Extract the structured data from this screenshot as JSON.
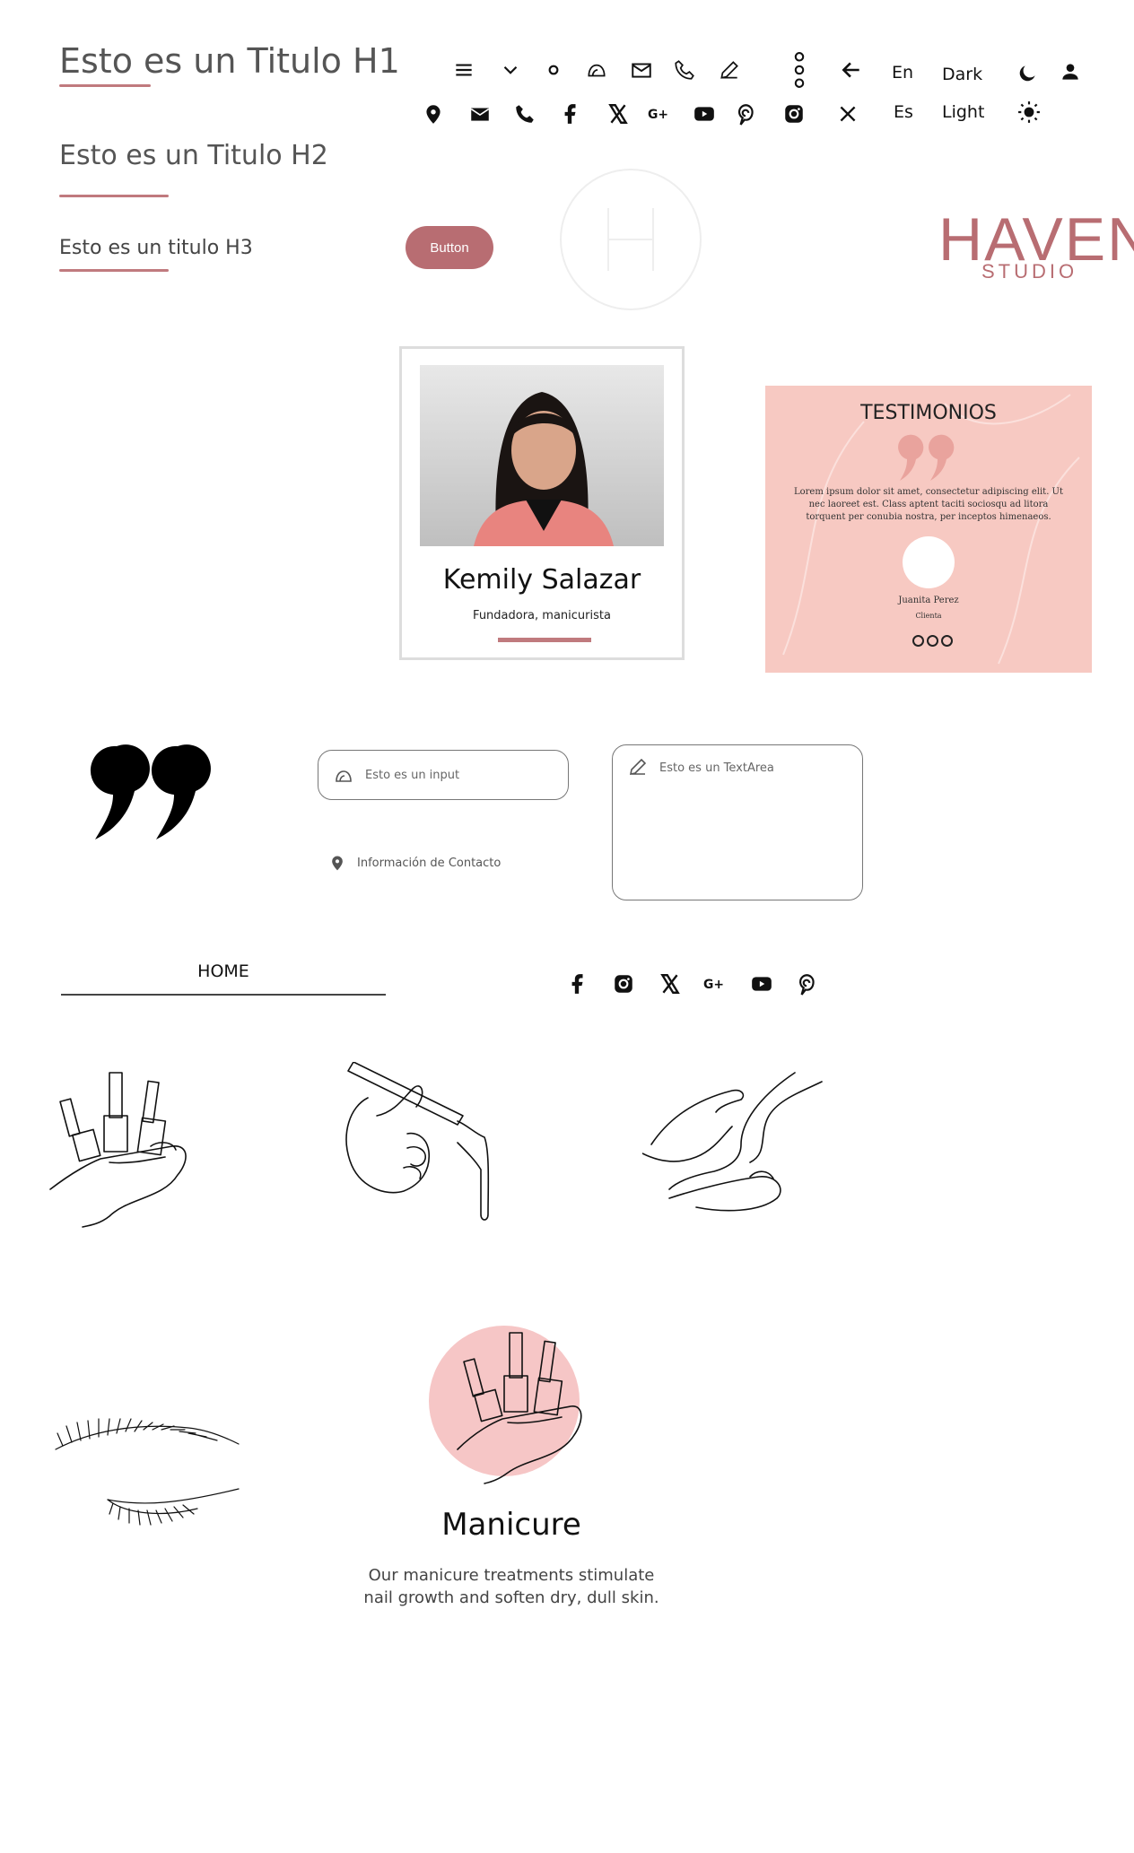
{
  "headings": {
    "h1": "Esto es un Titulo H1",
    "h2": "Esto es un Titulo H2",
    "h3": "Esto es un titulo H3"
  },
  "button": {
    "label": "Button"
  },
  "toolbar_row1": [
    "menu-icon",
    "chevron-down-icon",
    "circle-icon",
    "helmet-icon",
    "mail-outline-icon",
    "phone-outline-icon",
    "pencil-icon",
    "more-vertical-icon",
    "arrow-left-icon"
  ],
  "toolbar_row2": [
    "location-icon",
    "mail-icon",
    "phone-icon",
    "facebook-icon",
    "x-icon",
    "google-plus-icon",
    "youtube-icon",
    "pinterest-icon",
    "instagram-icon",
    "close-icon"
  ],
  "language": {
    "en": "En",
    "es": "Es"
  },
  "theme": {
    "dark": "Dark",
    "light": "Light"
  },
  "logo": {
    "name": "HAVEN",
    "sub": "STUDIO"
  },
  "profile_card": {
    "name": "Kemily Salazar",
    "role": "Fundadora, manicurista"
  },
  "testimonial": {
    "title": "TESTIMONIOS",
    "text": "Lorem ipsum dolor sit amet, consectetur adipiscing elit. Ut nec laoreet est. Class aptent taciti sociosqu ad litora torquent per conubia nostra, per inceptos himenaeos.",
    "name": "Juanita Perez",
    "role": "Clienta"
  },
  "form": {
    "input_placeholder": "Esto es un input",
    "textarea_placeholder": "Esto es un TextArea",
    "contact": "Información de Contacto"
  },
  "nav": {
    "home": "HOME"
  },
  "social_icons": [
    "facebook-icon",
    "instagram-icon",
    "x-icon",
    "google-plus-icon",
    "youtube-icon",
    "pinterest-icon"
  ],
  "service": {
    "title": "Manicure",
    "description_line1": "Our manicure treatments stimulate",
    "description_line2": "nail growth and soften dry, dull skin."
  },
  "colors": {
    "accent": "#b86d72",
    "testimonial_bg": "#f7c9c2",
    "accent_light": "#f6c6c6"
  }
}
